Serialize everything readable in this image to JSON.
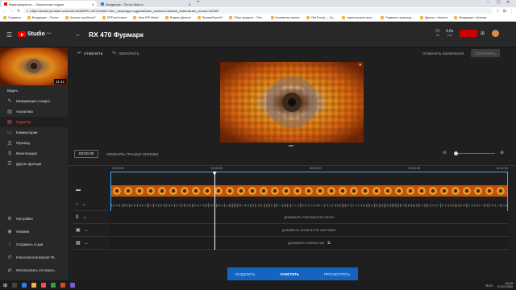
{
  "browser": {
    "tabs": [
      {
        "title": "Видеоредактор – Творческая студия",
        "color": "#ff0000",
        "active": true
      },
      {
        "title": "Входящие - Почта Mail.ru",
        "color": "#168de2",
        "active": false
      }
    ],
    "url": "https://studio.youtube.com/video/K8MRR-L5Z7o/editor?utm_campaign=upgrade&utm_medium=sidebar_button&utm_source=NONE",
    "bookmarks": [
      "Сервисы",
      "Входящие – Почта",
      "Хочешь прибыль?",
      "DPDnet новое",
      "Моя DPI Metal",
      "Яндекс.Деньги",
      "ПриватБанк24",
      "Сбор средств – Пат...",
      "Конвертер валют",
      "Get Emoji — Co...",
      "партнерская прог...",
      "Главная страница...",
      "Джоны • Аналит",
      "Входящие • Аналит"
    ]
  },
  "header": {
    "logo_text": "Studio",
    "logo_badge": "beta",
    "video_title": "RX 470 Фурмарк",
    "stat1_top": "95",
    "stat1_bottom": "34",
    "stat2_top": "4.6к",
    "stat2_bottom": "102"
  },
  "toolbar": {
    "undo_label": "ОТМЕНИТЬ",
    "redo_label": "ПОВТОРИТЬ",
    "discard_label": "ОТМЕНИТЬ ИЗМЕНЕНИЯ",
    "save_label": "СОХРАНИТЬ"
  },
  "sidebar": {
    "thumb_duration": "11:42",
    "section_label": "Видео",
    "items": [
      {
        "label": "Информация о видео",
        "icon": "pencil-icon",
        "active": false
      },
      {
        "label": "Аналитика",
        "icon": "chart-icon",
        "active": false
      },
      {
        "label": "Редактор",
        "icon": "film-icon",
        "active": true
      },
      {
        "label": "Комментарии",
        "icon": "comment-icon",
        "active": false
      },
      {
        "label": "Перевод",
        "icon": "translate-icon",
        "active": false
      },
      {
        "label": "Монетизация",
        "icon": "dollar-icon",
        "active": false
      },
      {
        "label": "Другие функции",
        "icon": "more-icon",
        "active": false
      }
    ],
    "bottom_items": [
      {
        "label": "Настройки",
        "icon": "gear-icon"
      },
      {
        "label": "Новинки",
        "icon": "news-icon"
      },
      {
        "label": "Отправить отзыв",
        "icon": "feedback-icon"
      },
      {
        "label": "Классическая версия Тв...",
        "icon": "classic-icon"
      },
      {
        "label": "Использовать эту верси...",
        "icon": "switch-icon"
      }
    ]
  },
  "editor": {
    "current_time": "03:00:30",
    "trim_label": "ИЗМЕНИТЬ ГРАНИЦУ ОБРЕЗКИ",
    "timeline_marks": [
      "00:00:00",
      "03:00:00",
      "06:00:00",
      "09:00:00",
      "11:42:01"
    ],
    "playhead_fraction": 0.26,
    "tracks": {
      "ads": "ДОБАВИТЬ РЕКЛАМНУЮ ПАУЗУ",
      "endscreen": "ДОБАВИТЬ КОНЕЧНУЮ ЗАСТАВКУ",
      "blur": "ДОБАВИТЬ РАЗМЫТИЕ"
    },
    "bottom_actions": {
      "split": "РАЗДЕЛИТЬ",
      "clear": "ОЧИСТИТЬ",
      "preview": "ПРОСМОТРЕТЬ"
    }
  },
  "taskbar": {
    "lang": "RUS",
    "time": "16:33",
    "date": "07.02.2020"
  },
  "colors": {
    "accent_red": "#ff4e45",
    "accent_blue": "#3ea6ff",
    "action_bar": "#1565c0"
  }
}
